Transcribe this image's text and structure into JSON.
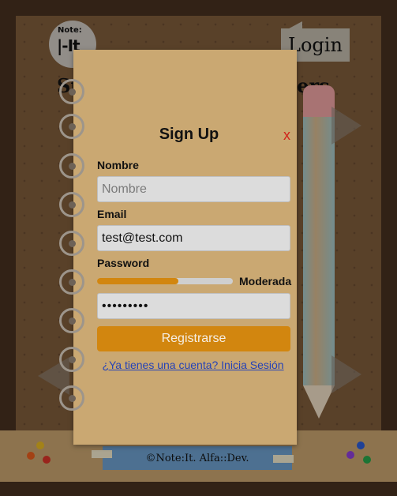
{
  "background": {
    "logo": {
      "small": "Note:",
      "big": "|-It"
    },
    "login_label": "Login",
    "title_left": "Sto",
    "title_right": "tters",
    "footer_text": "©Note:It. Alfa::Dev."
  },
  "form": {
    "title": "Sign Up",
    "close": "x",
    "nombre": {
      "label": "Nombre",
      "placeholder": "Nombre",
      "value": ""
    },
    "email": {
      "label": "Email",
      "value": "test@test.com"
    },
    "password": {
      "label": "Password",
      "value": "•••••••••",
      "strength_label": "Moderada",
      "strength_percent": 60
    },
    "submit": "Registrarse",
    "login_link": "¿Ya tienes una cuenta? Inicia Sesión"
  },
  "colors": {
    "accent": "#d2860f",
    "close": "#d1231b",
    "link": "#2442b8"
  }
}
